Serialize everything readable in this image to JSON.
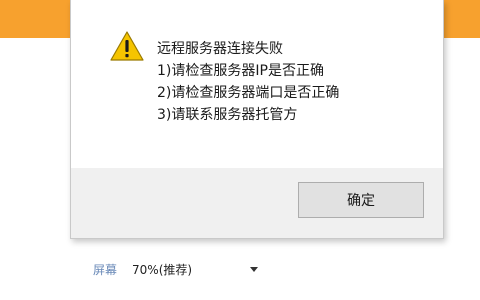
{
  "dialog": {
    "message_lines": [
      "远程服务器连接失败",
      "1)请检查服务器IP是否正确",
      "2)请检查服务器端口是否正确",
      "3)请联系服务器托管方"
    ],
    "ok_label": "确定",
    "icon": "warning-icon"
  },
  "settings": {
    "screen_label": "屏幕",
    "screen_value": "70%(推荐)"
  },
  "colors": {
    "header_band": "#f7a12e",
    "warning_yellow": "#f5c400",
    "dialog_footer": "#f0f0f0",
    "button_bg": "#e1e1e1",
    "label_blue": "#6a8ab8"
  }
}
